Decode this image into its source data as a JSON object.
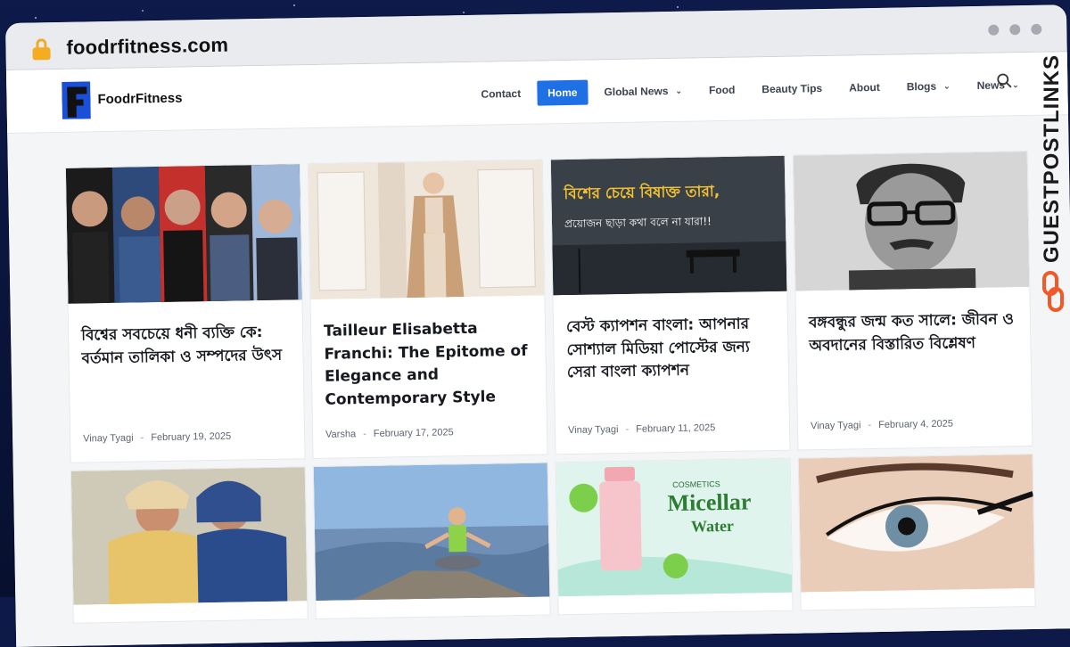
{
  "browser": {
    "url": "foodrfitness.com"
  },
  "site": {
    "logo_text": "FoodrFitness",
    "menu": [
      {
        "label": "Contact",
        "active": false,
        "has_dropdown": false
      },
      {
        "label": "Home",
        "active": true,
        "has_dropdown": false
      },
      {
        "label": "Global News",
        "active": false,
        "has_dropdown": true
      },
      {
        "label": "Food",
        "active": false,
        "has_dropdown": false
      },
      {
        "label": "Beauty Tips",
        "active": false,
        "has_dropdown": false
      },
      {
        "label": "About",
        "active": false,
        "has_dropdown": false
      },
      {
        "label": "Blogs",
        "active": false,
        "has_dropdown": true
      },
      {
        "label": "News",
        "active": false,
        "has_dropdown": true
      }
    ],
    "accent": "#1f6fe5"
  },
  "posts": [
    {
      "title": "বিশ্বের সবচেয়ে ধনী ব্যক্তি কে: বর্তমান তালিকা ও সম্পদের উৎস",
      "author": "Vinay Tyagi",
      "date": "February 19, 2025",
      "image": "portrait-collage-icon"
    },
    {
      "title": "Tailleur Elisabetta Franchi: The Epitome of Elegance and Contemporary Style",
      "author": "Varsha",
      "date": "February 17, 2025",
      "image": "fashion-model-icon"
    },
    {
      "title": "বেস্ট ক্যাপশন বাংলা: আপনার সোশ্যাল মিডিয়া পোস্টের জন্য সেরা বাংলা ক্যাপশন",
      "author": "Vinay Tyagi",
      "date": "February 11, 2025",
      "image": "caption-quote-icon"
    },
    {
      "title": "বঙ্গবন্ধুর জন্ম কত সালে: জীবন ও অবদানের বিস্তারিত বিশ্লেষণ",
      "author": "Vinay Tyagi",
      "date": "February 4, 2025",
      "image": "bw-portrait-icon"
    },
    {
      "title": "",
      "author": "",
      "date": "",
      "image": "couple-rain-icon"
    },
    {
      "title": "",
      "author": "",
      "date": "",
      "image": "yoga-mountain-icon"
    },
    {
      "title": "",
      "author": "",
      "date": "",
      "image": "micellar-water-icon"
    },
    {
      "title": "",
      "author": "",
      "date": "",
      "image": "eyeliner-icon"
    }
  ],
  "caption_image": {
    "line1": "বিশের চেয়ে বিষাক্ত তারা,",
    "line2": "প্রয়োজন ছাড়া কথা বলে না যারা!!"
  },
  "micellar_image": {
    "small": "COSMETICS",
    "brand": "Micellar",
    "brand2": "Water"
  },
  "sidebrand": {
    "text": "GUESTPOSTLINKS",
    "color": "#f05a28"
  }
}
